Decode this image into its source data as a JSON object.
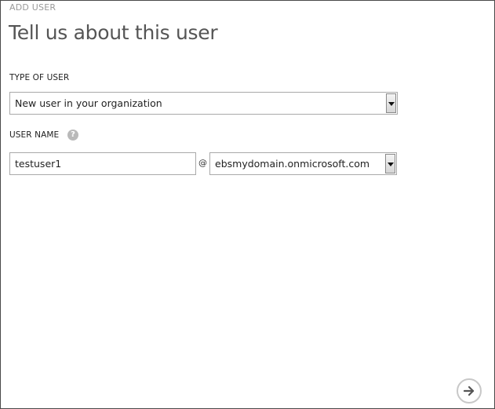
{
  "dialog": {
    "section_label": "ADD USER",
    "title": "Tell us about this user"
  },
  "type_of_user": {
    "label": "TYPE OF USER",
    "selected": "New user in your organization"
  },
  "user_name": {
    "label": "USER NAME",
    "help_icon": "question-mark-icon",
    "value": "testuser1",
    "at_symbol": "@",
    "domain_selected": "ebsmydomain.onmicrosoft.com"
  },
  "footer": {
    "next_icon": "arrow-right-icon"
  }
}
